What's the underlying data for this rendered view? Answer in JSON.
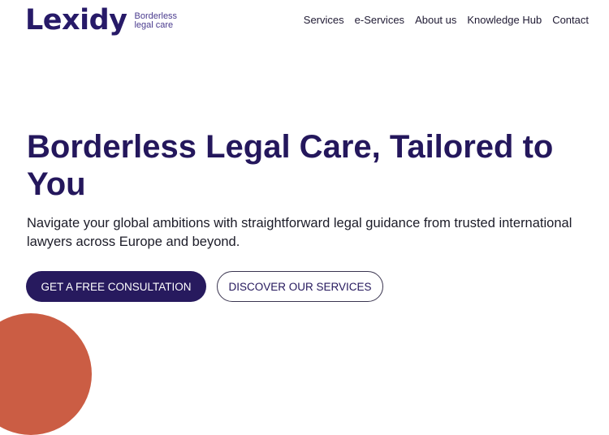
{
  "brand": {
    "name": "Lexidy",
    "tagline_line1": "Borderless",
    "tagline_line2": "legal care"
  },
  "nav": {
    "items": [
      {
        "label": "Services"
      },
      {
        "label": "e-Services"
      },
      {
        "label": "About us"
      },
      {
        "label": "Knowledge Hub"
      },
      {
        "label": "Contact"
      }
    ]
  },
  "hero": {
    "title": "Borderless Legal Care, Tailored to You",
    "subtitle": "Navigate your global ambitions with straightforward legal guidance from trusted international lawyers across Europe and beyond.",
    "primary_cta": "GET A FREE CONSULTATION",
    "secondary_cta": "DISCOVER OUR SERVICES"
  },
  "colors": {
    "brand_navy": "#271a5e",
    "accent_coral": "#cb5d44",
    "background": "#ffffff"
  }
}
